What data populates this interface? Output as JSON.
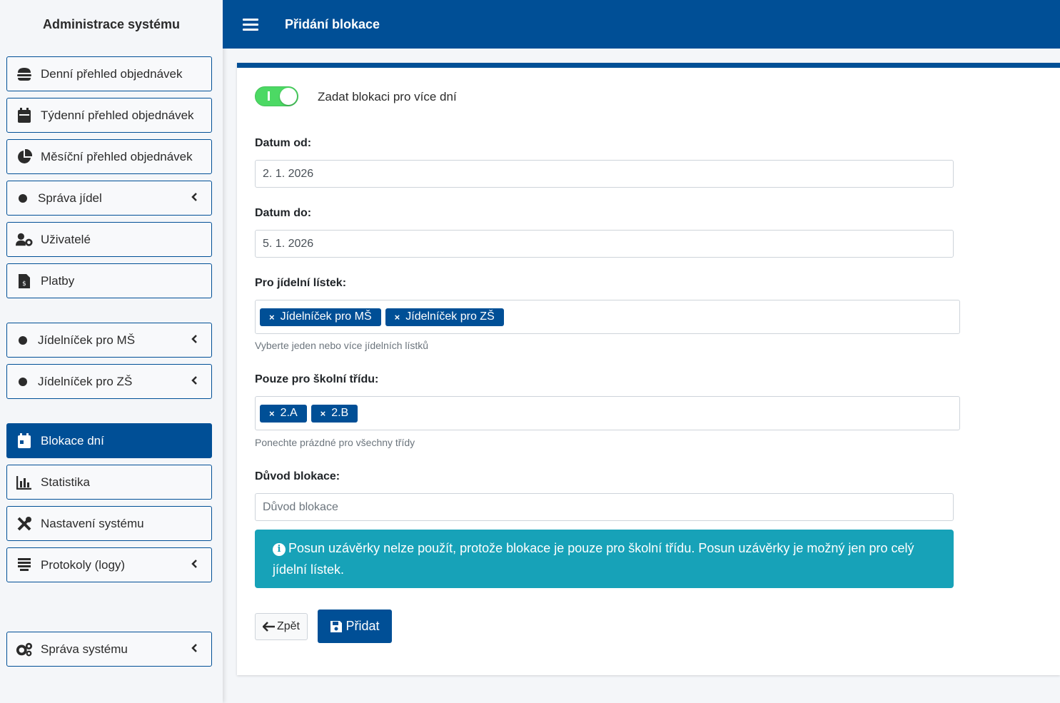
{
  "brand": "Administrace systému",
  "page_title": "Přidání blokace",
  "sidebar": {
    "items": [
      {
        "label": "Denní přehled objednávek",
        "icon": "hamburger-food-icon"
      },
      {
        "label": "Týdenní přehled objednávek",
        "icon": "calendar-icon"
      },
      {
        "label": "Měsíční přehled objednávek",
        "icon": "pie-chart-icon"
      },
      {
        "label": "Správa jídel",
        "icon": "circle-icon"
      },
      {
        "label": "Uživatelé",
        "icon": "users-cog-icon"
      },
      {
        "label": "Platby",
        "icon": "invoice-dollar-icon"
      },
      {
        "label": "Jídelníček pro MŠ",
        "icon": "circle-icon"
      },
      {
        "label": "Jídelníček pro ZŠ",
        "icon": "circle-icon"
      },
      {
        "label": "Blokace dní",
        "icon": "calendar-icon",
        "active": true
      },
      {
        "label": "Statistika",
        "icon": "bar-chart-icon"
      },
      {
        "label": "Nastavení systému",
        "icon": "tools-icon"
      },
      {
        "label": "Protokoly (logy)",
        "icon": "list-icon"
      },
      {
        "label": "Správa systému",
        "icon": "cogs-icon"
      }
    ]
  },
  "form": {
    "multi_day_label": "Zadat blokaci pro více dní",
    "multi_day_on": true,
    "date_from_label": "Datum od:",
    "date_from_value": "2. 1. 2026",
    "date_to_label": "Datum do:",
    "date_to_value": "5. 1. 2026",
    "menu_label": "Pro jídelní lístek:",
    "menu_tags": [
      "Jídelníček pro MŠ",
      "Jídelníček pro ZŠ"
    ],
    "menu_help": "Vyberte jeden nebo více jídelních lístků",
    "class_label": "Pouze pro školní třídu:",
    "class_tags": [
      "2.A",
      "2.B"
    ],
    "class_help": "Ponechte prázdné pro všechny třídy",
    "reason_label": "Důvod blokace:",
    "reason_placeholder": "Důvod blokace",
    "alert_text": "Posun uzávěrky nelze použít, protože blokace je pouze pro školní třídu. Posun uzávěrky je možný jen pro celý jídelní lístek.",
    "back_label": "Zpět",
    "add_label": "Přidat"
  },
  "colors": {
    "primary": "#004f96",
    "info": "#17a2b8",
    "switch_on": "#4cd964"
  }
}
